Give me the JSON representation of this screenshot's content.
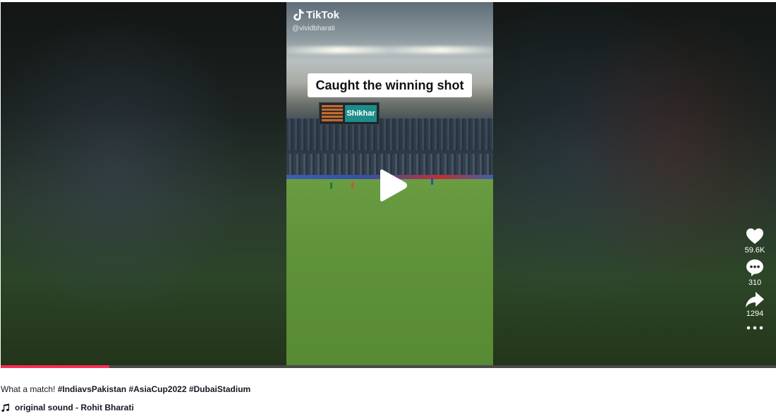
{
  "video": {
    "brand": "TikTok",
    "handle": "@vividbharati",
    "caption_sticker": "Caught the winning shot",
    "scoreboard_text": "Shikhar",
    "progress_percent": 14
  },
  "actions": {
    "likes": "59.6K",
    "comments": "310",
    "shares": "1294"
  },
  "description": {
    "text": "What a match!",
    "hashtags": [
      "#IndiavsPakistan",
      "#AsiaCup2022",
      "#DubaiStadium"
    ]
  },
  "music": {
    "label": "original sound - Rohit Bharati"
  },
  "colors": {
    "accent": "#fe2c55",
    "text": "#161823"
  }
}
